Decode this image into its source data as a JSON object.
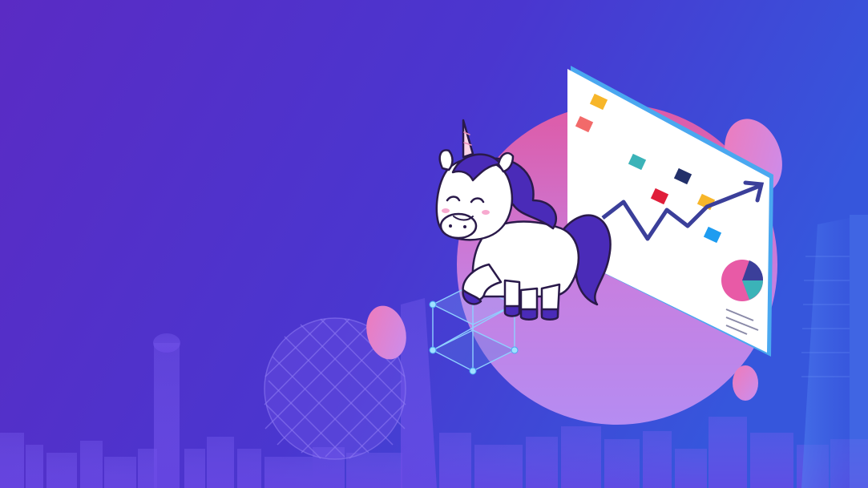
{
  "scene": {
    "description_label": "",
    "colors": {
      "bg_left": "#5a2dc8",
      "bg_right": "#3a4fd8",
      "skyline": "#6a4fe0",
      "orb_top": "#d85aa8",
      "orb_bottom": "#b98cf0",
      "board": "#ffffff",
      "board_edge": "#4aa8f0",
      "arrow": "#3b3f9a",
      "mane": "#4a2bb8",
      "unicorn_body": "#ffffff"
    },
    "icons": [
      "unicorn-illustration",
      "chart-board",
      "pie-chart-icon",
      "trend-arrow-icon",
      "wireframe-cube-icon",
      "skyline-illustration"
    ]
  }
}
